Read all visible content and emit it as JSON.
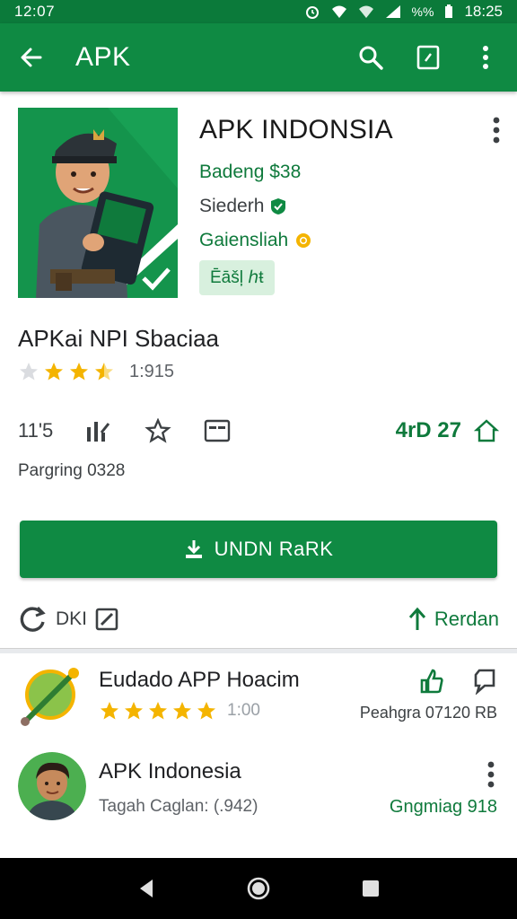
{
  "status": {
    "time_left": "12:07",
    "time_right": "18:25",
    "battery_text": "%%"
  },
  "appbar": {
    "title": "APK"
  },
  "app": {
    "name": "APK INDONSIA",
    "developer": "Badeng $38",
    "line2": "Siederh",
    "line3": "Gaiensliah",
    "chip": "Ēāšļ ℎŧ"
  },
  "section": {
    "title": "APKai NPI Sbaciaa",
    "rating_count": "1:915",
    "rating": 3.5
  },
  "stats": {
    "stat1": "11'5",
    "right_text": "4rD 27"
  },
  "paging": "Pargring 0328",
  "install": {
    "label": "UNDN RaRK"
  },
  "sub_actions": {
    "left_label": "DKI",
    "right_label": "Rerdan"
  },
  "list": [
    {
      "title": "Eudado APP Hoacim",
      "rating_text": "1:00",
      "rating": 5,
      "right_sub": "Peahgra 07120 RB"
    },
    {
      "title": "APK Indonesia",
      "sub": "Tagah Caglan: (.942)",
      "right_sub": "Gngmiag 918"
    }
  ],
  "colors": {
    "brand": "#0f8a43",
    "status": "#0b7a3a",
    "accent_text": "#0f7a3c",
    "star": "#f4b400"
  },
  "icons": [
    "back-arrow-icon",
    "search-icon",
    "edit-icon",
    "more-vert-icon",
    "star-icon",
    "share-icon",
    "download-icon",
    "home-icon",
    "back-nav-icon",
    "recents-icon"
  ]
}
